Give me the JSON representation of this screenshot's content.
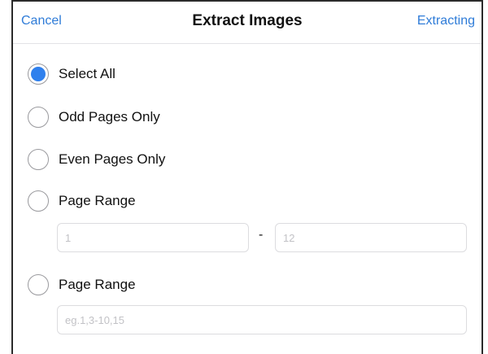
{
  "navbar": {
    "cancel_label": "Cancel",
    "title": "Extract Images",
    "action_label": "Extracting",
    "accent_color": "#2f7cd8"
  },
  "options": [
    {
      "label": "Select All",
      "selected": true
    },
    {
      "label": "Odd Pages Only",
      "selected": false
    },
    {
      "label": "Even Pages Only",
      "selected": false
    },
    {
      "label": "Page Range",
      "selected": false
    },
    {
      "label": "Page Range",
      "selected": false
    }
  ],
  "range": {
    "from_placeholder": "1",
    "separator": "-",
    "to_placeholder": "12"
  },
  "custom_range": {
    "placeholder": "eg.1,3-10,15"
  },
  "colors": {
    "radio_selected": "#2f80ed",
    "radio_border": "#9a9a9e"
  }
}
